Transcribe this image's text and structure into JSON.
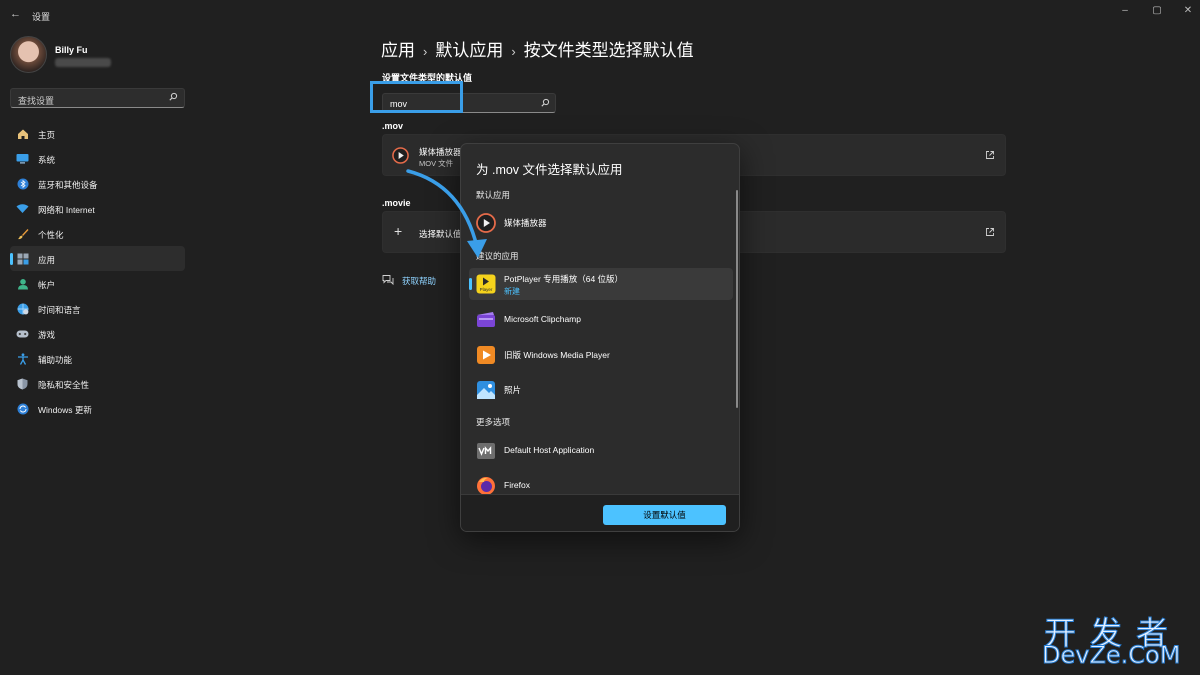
{
  "window": {
    "title": "设置",
    "controls": [
      "–",
      "▢",
      "✕"
    ]
  },
  "user": {
    "name": "Billy Fu"
  },
  "sidebar": {
    "search_placeholder": "查找设置",
    "items": [
      {
        "label": "主页",
        "icon": "home-icon"
      },
      {
        "label": "系统",
        "icon": "system-icon"
      },
      {
        "label": "蓝牙和其他设备",
        "icon": "bluetooth-icon"
      },
      {
        "label": "网络和 Internet",
        "icon": "wifi-icon"
      },
      {
        "label": "个性化",
        "icon": "brush-icon"
      },
      {
        "label": "应用",
        "icon": "apps-icon",
        "selected": true
      },
      {
        "label": "帐户",
        "icon": "account-icon"
      },
      {
        "label": "时间和语言",
        "icon": "globe-clock-icon"
      },
      {
        "label": "游戏",
        "icon": "gamepad-icon"
      },
      {
        "label": "辅助功能",
        "icon": "accessibility-icon"
      },
      {
        "label": "隐私和安全性",
        "icon": "shield-icon"
      },
      {
        "label": "Windows 更新",
        "icon": "update-icon"
      }
    ]
  },
  "breadcrumb": {
    "items": [
      "应用",
      "默认应用",
      "按文件类型选择默认值"
    ],
    "separator": "›"
  },
  "main": {
    "section_title": "设置文件类型的默认值",
    "search_value": "mov",
    "mov": {
      "ext": ".mov",
      "app_name": "媒体播放器",
      "file_type": "MOV 文件"
    },
    "movie": {
      "ext": ".movie",
      "choose_label": "选择默认值"
    },
    "help_link": "获取帮助"
  },
  "dialog": {
    "title": "为 .mov 文件选择默认应用",
    "default_section": "默认应用",
    "default_app": "媒体播放器",
    "suggested_section": "建议的应用",
    "suggested_apps": [
      {
        "name": "PotPlayer 专用播放（64 位版）",
        "tag": "新建",
        "selected": true,
        "icon": "potplayer-icon"
      },
      {
        "name": "Microsoft Clipchamp",
        "icon": "clipchamp-icon"
      },
      {
        "name": "旧版 Windows Media Player",
        "icon": "wmp-icon"
      },
      {
        "name": "照片",
        "icon": "photos-icon"
      }
    ],
    "more_section": "更多选项",
    "more_apps": [
      {
        "name": "Default Host Application",
        "icon": "vmware-icon"
      },
      {
        "name": "Firefox",
        "icon": "firefox-icon"
      }
    ],
    "confirm_label": "设置默认值",
    "potplayer_icon_text": "Player"
  },
  "watermark": {
    "line1": "开发者",
    "line2": "DevZe.CoM"
  },
  "colors": {
    "accent": "#4cc2ff",
    "background": "#202020",
    "highlight": "#3a9ee8"
  }
}
